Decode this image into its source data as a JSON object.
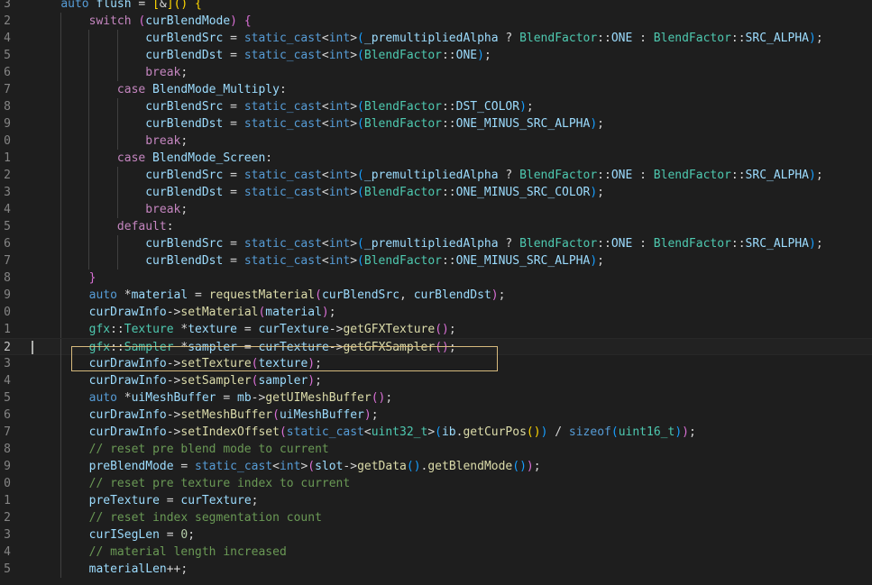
{
  "lines": [
    {
      "num": "3",
      "indent": 2,
      "tokens": [
        [
          "auto",
          "kw"
        ],
        [
          " flush ",
          "var"
        ],
        [
          "= ",
          "p"
        ],
        [
          "[",
          "br1"
        ],
        [
          "&",
          "p"
        ],
        [
          "]",
          "br1"
        ],
        [
          "(",
          "br1"
        ],
        [
          ")",
          "br1"
        ],
        [
          " ",
          "p"
        ],
        [
          "{",
          "br1"
        ]
      ]
    },
    {
      "num": "2",
      "indent": 4,
      "tokens": [
        [
          "switch",
          "ctrl"
        ],
        [
          " ",
          "p"
        ],
        [
          "(",
          "br2"
        ],
        [
          "curBlendMode",
          "var"
        ],
        [
          ")",
          "br2"
        ],
        [
          " ",
          "p"
        ],
        [
          "{",
          "br2"
        ]
      ]
    },
    {
      "num": "4",
      "indent": 8,
      "tokens": [
        [
          "curBlendSrc",
          "var"
        ],
        [
          " = ",
          "p"
        ],
        [
          "static_cast",
          "kw"
        ],
        [
          "<",
          "p"
        ],
        [
          "int",
          "kw"
        ],
        [
          ">",
          "p"
        ],
        [
          "(",
          "br3"
        ],
        [
          "_premultipliedAlpha",
          "var"
        ],
        [
          " ? ",
          "p"
        ],
        [
          "BlendFactor",
          "type"
        ],
        [
          "::",
          "p"
        ],
        [
          "ONE",
          "var"
        ],
        [
          " : ",
          "p"
        ],
        [
          "BlendFactor",
          "type"
        ],
        [
          "::",
          "p"
        ],
        [
          "SRC_ALPHA",
          "var"
        ],
        [
          ")",
          "br3"
        ],
        [
          ";",
          "p"
        ]
      ]
    },
    {
      "num": "5",
      "indent": 8,
      "tokens": [
        [
          "curBlendDst",
          "var"
        ],
        [
          " = ",
          "p"
        ],
        [
          "static_cast",
          "kw"
        ],
        [
          "<",
          "p"
        ],
        [
          "int",
          "kw"
        ],
        [
          ">",
          "p"
        ],
        [
          "(",
          "br3"
        ],
        [
          "BlendFactor",
          "type"
        ],
        [
          "::",
          "p"
        ],
        [
          "ONE",
          "var"
        ],
        [
          ")",
          "br3"
        ],
        [
          ";",
          "p"
        ]
      ]
    },
    {
      "num": "6",
      "indent": 8,
      "tokens": [
        [
          "break",
          "ctrl"
        ],
        [
          ";",
          "p"
        ]
      ]
    },
    {
      "num": "7",
      "indent": 6,
      "tokens": [
        [
          "case",
          "ctrl"
        ],
        [
          " BlendMode_Multiply",
          "var"
        ],
        [
          ":",
          "p"
        ]
      ]
    },
    {
      "num": "8",
      "indent": 8,
      "tokens": [
        [
          "curBlendSrc",
          "var"
        ],
        [
          " = ",
          "p"
        ],
        [
          "static_cast",
          "kw"
        ],
        [
          "<",
          "p"
        ],
        [
          "int",
          "kw"
        ],
        [
          ">",
          "p"
        ],
        [
          "(",
          "br3"
        ],
        [
          "BlendFactor",
          "type"
        ],
        [
          "::",
          "p"
        ],
        [
          "DST_COLOR",
          "var"
        ],
        [
          ")",
          "br3"
        ],
        [
          ";",
          "p"
        ]
      ]
    },
    {
      "num": "9",
      "indent": 8,
      "tokens": [
        [
          "curBlendDst",
          "var"
        ],
        [
          " = ",
          "p"
        ],
        [
          "static_cast",
          "kw"
        ],
        [
          "<",
          "p"
        ],
        [
          "int",
          "kw"
        ],
        [
          ">",
          "p"
        ],
        [
          "(",
          "br3"
        ],
        [
          "BlendFactor",
          "type"
        ],
        [
          "::",
          "p"
        ],
        [
          "ONE_MINUS_SRC_ALPHA",
          "var"
        ],
        [
          ")",
          "br3"
        ],
        [
          ";",
          "p"
        ]
      ]
    },
    {
      "num": "0",
      "indent": 8,
      "tokens": [
        [
          "break",
          "ctrl"
        ],
        [
          ";",
          "p"
        ]
      ]
    },
    {
      "num": "1",
      "indent": 6,
      "tokens": [
        [
          "case",
          "ctrl"
        ],
        [
          " BlendMode_Screen",
          "var"
        ],
        [
          ":",
          "p"
        ]
      ]
    },
    {
      "num": "2",
      "indent": 8,
      "tokens": [
        [
          "curBlendSrc",
          "var"
        ],
        [
          " = ",
          "p"
        ],
        [
          "static_cast",
          "kw"
        ],
        [
          "<",
          "p"
        ],
        [
          "int",
          "kw"
        ],
        [
          ">",
          "p"
        ],
        [
          "(",
          "br3"
        ],
        [
          "_premultipliedAlpha",
          "var"
        ],
        [
          " ? ",
          "p"
        ],
        [
          "BlendFactor",
          "type"
        ],
        [
          "::",
          "p"
        ],
        [
          "ONE",
          "var"
        ],
        [
          " : ",
          "p"
        ],
        [
          "BlendFactor",
          "type"
        ],
        [
          "::",
          "p"
        ],
        [
          "SRC_ALPHA",
          "var"
        ],
        [
          ")",
          "br3"
        ],
        [
          ";",
          "p"
        ]
      ]
    },
    {
      "num": "3",
      "indent": 8,
      "tokens": [
        [
          "curBlendDst",
          "var"
        ],
        [
          " = ",
          "p"
        ],
        [
          "static_cast",
          "kw"
        ],
        [
          "<",
          "p"
        ],
        [
          "int",
          "kw"
        ],
        [
          ">",
          "p"
        ],
        [
          "(",
          "br3"
        ],
        [
          "BlendFactor",
          "type"
        ],
        [
          "::",
          "p"
        ],
        [
          "ONE_MINUS_SRC_COLOR",
          "var"
        ],
        [
          ")",
          "br3"
        ],
        [
          ";",
          "p"
        ]
      ]
    },
    {
      "num": "4",
      "indent": 8,
      "tokens": [
        [
          "break",
          "ctrl"
        ],
        [
          ";",
          "p"
        ]
      ]
    },
    {
      "num": "5",
      "indent": 6,
      "tokens": [
        [
          "default",
          "ctrl"
        ],
        [
          ":",
          "p"
        ]
      ]
    },
    {
      "num": "6",
      "indent": 8,
      "tokens": [
        [
          "curBlendSrc",
          "var"
        ],
        [
          " = ",
          "p"
        ],
        [
          "static_cast",
          "kw"
        ],
        [
          "<",
          "p"
        ],
        [
          "int",
          "kw"
        ],
        [
          ">",
          "p"
        ],
        [
          "(",
          "br3"
        ],
        [
          "_premultipliedAlpha",
          "var"
        ],
        [
          " ? ",
          "p"
        ],
        [
          "BlendFactor",
          "type"
        ],
        [
          "::",
          "p"
        ],
        [
          "ONE",
          "var"
        ],
        [
          " : ",
          "p"
        ],
        [
          "BlendFactor",
          "type"
        ],
        [
          "::",
          "p"
        ],
        [
          "SRC_ALPHA",
          "var"
        ],
        [
          ")",
          "br3"
        ],
        [
          ";",
          "p"
        ]
      ]
    },
    {
      "num": "7",
      "indent": 8,
      "tokens": [
        [
          "curBlendDst",
          "var"
        ],
        [
          " = ",
          "p"
        ],
        [
          "static_cast",
          "kw"
        ],
        [
          "<",
          "p"
        ],
        [
          "int",
          "kw"
        ],
        [
          ">",
          "p"
        ],
        [
          "(",
          "br3"
        ],
        [
          "BlendFactor",
          "type"
        ],
        [
          "::",
          "p"
        ],
        [
          "ONE_MINUS_SRC_ALPHA",
          "var"
        ],
        [
          ")",
          "br3"
        ],
        [
          ";",
          "p"
        ]
      ]
    },
    {
      "num": "8",
      "indent": 4,
      "tokens": [
        [
          "}",
          "br2"
        ]
      ]
    },
    {
      "num": "9",
      "indent": 4,
      "tokens": [
        [
          "auto",
          "kw"
        ],
        [
          " *",
          "p"
        ],
        [
          "material",
          "var"
        ],
        [
          " = ",
          "p"
        ],
        [
          "requestMaterial",
          "fn"
        ],
        [
          "(",
          "br2"
        ],
        [
          "curBlendSrc",
          "var"
        ],
        [
          ", ",
          "p"
        ],
        [
          "curBlendDst",
          "var"
        ],
        [
          ")",
          "br2"
        ],
        [
          ";",
          "p"
        ]
      ]
    },
    {
      "num": "0",
      "indent": 4,
      "tokens": [
        [
          "curDrawInfo",
          "var"
        ],
        [
          "->",
          "p"
        ],
        [
          "setMaterial",
          "fn"
        ],
        [
          "(",
          "br2"
        ],
        [
          "material",
          "var"
        ],
        [
          ")",
          "br2"
        ],
        [
          ";",
          "p"
        ]
      ]
    },
    {
      "num": "1",
      "indent": 4,
      "tokens": [
        [
          "gfx",
          "type"
        ],
        [
          "::",
          "p"
        ],
        [
          "Texture",
          "type"
        ],
        [
          " *",
          "p"
        ],
        [
          "texture",
          "var"
        ],
        [
          " = ",
          "p"
        ],
        [
          "curTexture",
          "var"
        ],
        [
          "->",
          "p"
        ],
        [
          "getGFXTexture",
          "fn"
        ],
        [
          "(",
          "br2"
        ],
        [
          ")",
          "br2"
        ],
        [
          ";",
          "p"
        ]
      ]
    },
    {
      "num": "2",
      "indent": 4,
      "current": true,
      "tokens": [
        [
          "gfx",
          "type"
        ],
        [
          "::",
          "p"
        ],
        [
          "Sampler",
          "type"
        ],
        [
          " *",
          "p"
        ],
        [
          "sampler",
          "var"
        ],
        [
          " = ",
          "p"
        ],
        [
          "curTexture",
          "var"
        ],
        [
          "->",
          "p"
        ],
        [
          "getGFXSampler",
          "fn"
        ],
        [
          "(",
          "br2"
        ],
        [
          ")",
          "br2"
        ],
        [
          ";",
          "p"
        ]
      ]
    },
    {
      "num": "3",
      "indent": 4,
      "tokens": [
        [
          "curDrawInfo",
          "var"
        ],
        [
          "->",
          "p"
        ],
        [
          "setTexture",
          "fn"
        ],
        [
          "(",
          "br2"
        ],
        [
          "texture",
          "var"
        ],
        [
          ")",
          "br2"
        ],
        [
          ";",
          "p"
        ]
      ]
    },
    {
      "num": "4",
      "indent": 4,
      "tokens": [
        [
          "curDrawInfo",
          "var"
        ],
        [
          "->",
          "p"
        ],
        [
          "setSampler",
          "fn"
        ],
        [
          "(",
          "br2"
        ],
        [
          "sampler",
          "var"
        ],
        [
          ")",
          "br2"
        ],
        [
          ";",
          "p"
        ]
      ]
    },
    {
      "num": "5",
      "indent": 4,
      "tokens": [
        [
          "auto",
          "kw"
        ],
        [
          " *",
          "p"
        ],
        [
          "uiMeshBuffer",
          "var"
        ],
        [
          " = ",
          "p"
        ],
        [
          "mb",
          "var"
        ],
        [
          "->",
          "p"
        ],
        [
          "getUIMeshBuffer",
          "fn"
        ],
        [
          "(",
          "br2"
        ],
        [
          ")",
          "br2"
        ],
        [
          ";",
          "p"
        ]
      ]
    },
    {
      "num": "6",
      "indent": 4,
      "tokens": [
        [
          "curDrawInfo",
          "var"
        ],
        [
          "->",
          "p"
        ],
        [
          "setMeshBuffer",
          "fn"
        ],
        [
          "(",
          "br2"
        ],
        [
          "uiMeshBuffer",
          "var"
        ],
        [
          ")",
          "br2"
        ],
        [
          ";",
          "p"
        ]
      ]
    },
    {
      "num": "7",
      "indent": 4,
      "tokens": [
        [
          "curDrawInfo",
          "var"
        ],
        [
          "->",
          "p"
        ],
        [
          "setIndexOffset",
          "fn"
        ],
        [
          "(",
          "br2"
        ],
        [
          "static_cast",
          "kw"
        ],
        [
          "<",
          "p"
        ],
        [
          "uint32_t",
          "type"
        ],
        [
          ">",
          "p"
        ],
        [
          "(",
          "br3"
        ],
        [
          "ib",
          "var"
        ],
        [
          ".",
          "p"
        ],
        [
          "getCurPos",
          "fn"
        ],
        [
          "(",
          "br1"
        ],
        [
          ")",
          "br1"
        ],
        [
          ")",
          "br3"
        ],
        [
          " / ",
          "p"
        ],
        [
          "sizeof",
          "kw"
        ],
        [
          "(",
          "br3"
        ],
        [
          "uint16_t",
          "type"
        ],
        [
          ")",
          "br3"
        ],
        [
          ")",
          "br2"
        ],
        [
          ";",
          "p"
        ]
      ]
    },
    {
      "num": "8",
      "indent": 4,
      "tokens": [
        [
          "// reset pre blend mode to current",
          "cm"
        ]
      ]
    },
    {
      "num": "9",
      "indent": 4,
      "tokens": [
        [
          "preBlendMode",
          "var"
        ],
        [
          " = ",
          "p"
        ],
        [
          "static_cast",
          "kw"
        ],
        [
          "<",
          "p"
        ],
        [
          "int",
          "kw"
        ],
        [
          ">",
          "p"
        ],
        [
          "(",
          "br2"
        ],
        [
          "slot",
          "var"
        ],
        [
          "->",
          "p"
        ],
        [
          "getData",
          "fn"
        ],
        [
          "(",
          "br3"
        ],
        [
          ")",
          "br3"
        ],
        [
          ".",
          "p"
        ],
        [
          "getBlendMode",
          "fn"
        ],
        [
          "(",
          "br3"
        ],
        [
          ")",
          "br3"
        ],
        [
          ")",
          "br2"
        ],
        [
          ";",
          "p"
        ]
      ]
    },
    {
      "num": "0",
      "indent": 4,
      "tokens": [
        [
          "// reset pre texture index to current",
          "cm"
        ]
      ]
    },
    {
      "num": "1",
      "indent": 4,
      "tokens": [
        [
          "preTexture",
          "var"
        ],
        [
          " = ",
          "p"
        ],
        [
          "curTexture",
          "var"
        ],
        [
          ";",
          "p"
        ]
      ]
    },
    {
      "num": "2",
      "indent": 4,
      "tokens": [
        [
          "// reset index segmentation count",
          "cm"
        ]
      ]
    },
    {
      "num": "3",
      "indent": 4,
      "tokens": [
        [
          "curISegLen",
          "var"
        ],
        [
          " = ",
          "p"
        ],
        [
          "0",
          "num"
        ],
        [
          ";",
          "p"
        ]
      ]
    },
    {
      "num": "4",
      "indent": 4,
      "tokens": [
        [
          "// material length increased",
          "cm"
        ]
      ]
    },
    {
      "num": "5",
      "indent": 4,
      "tokens": [
        [
          "materialLen",
          "var"
        ],
        [
          "++",
          "p"
        ],
        [
          ";",
          "p"
        ]
      ]
    }
  ],
  "colors": {
    "background": "#1e1e1e",
    "highlight_border": "#d7ba7d"
  }
}
